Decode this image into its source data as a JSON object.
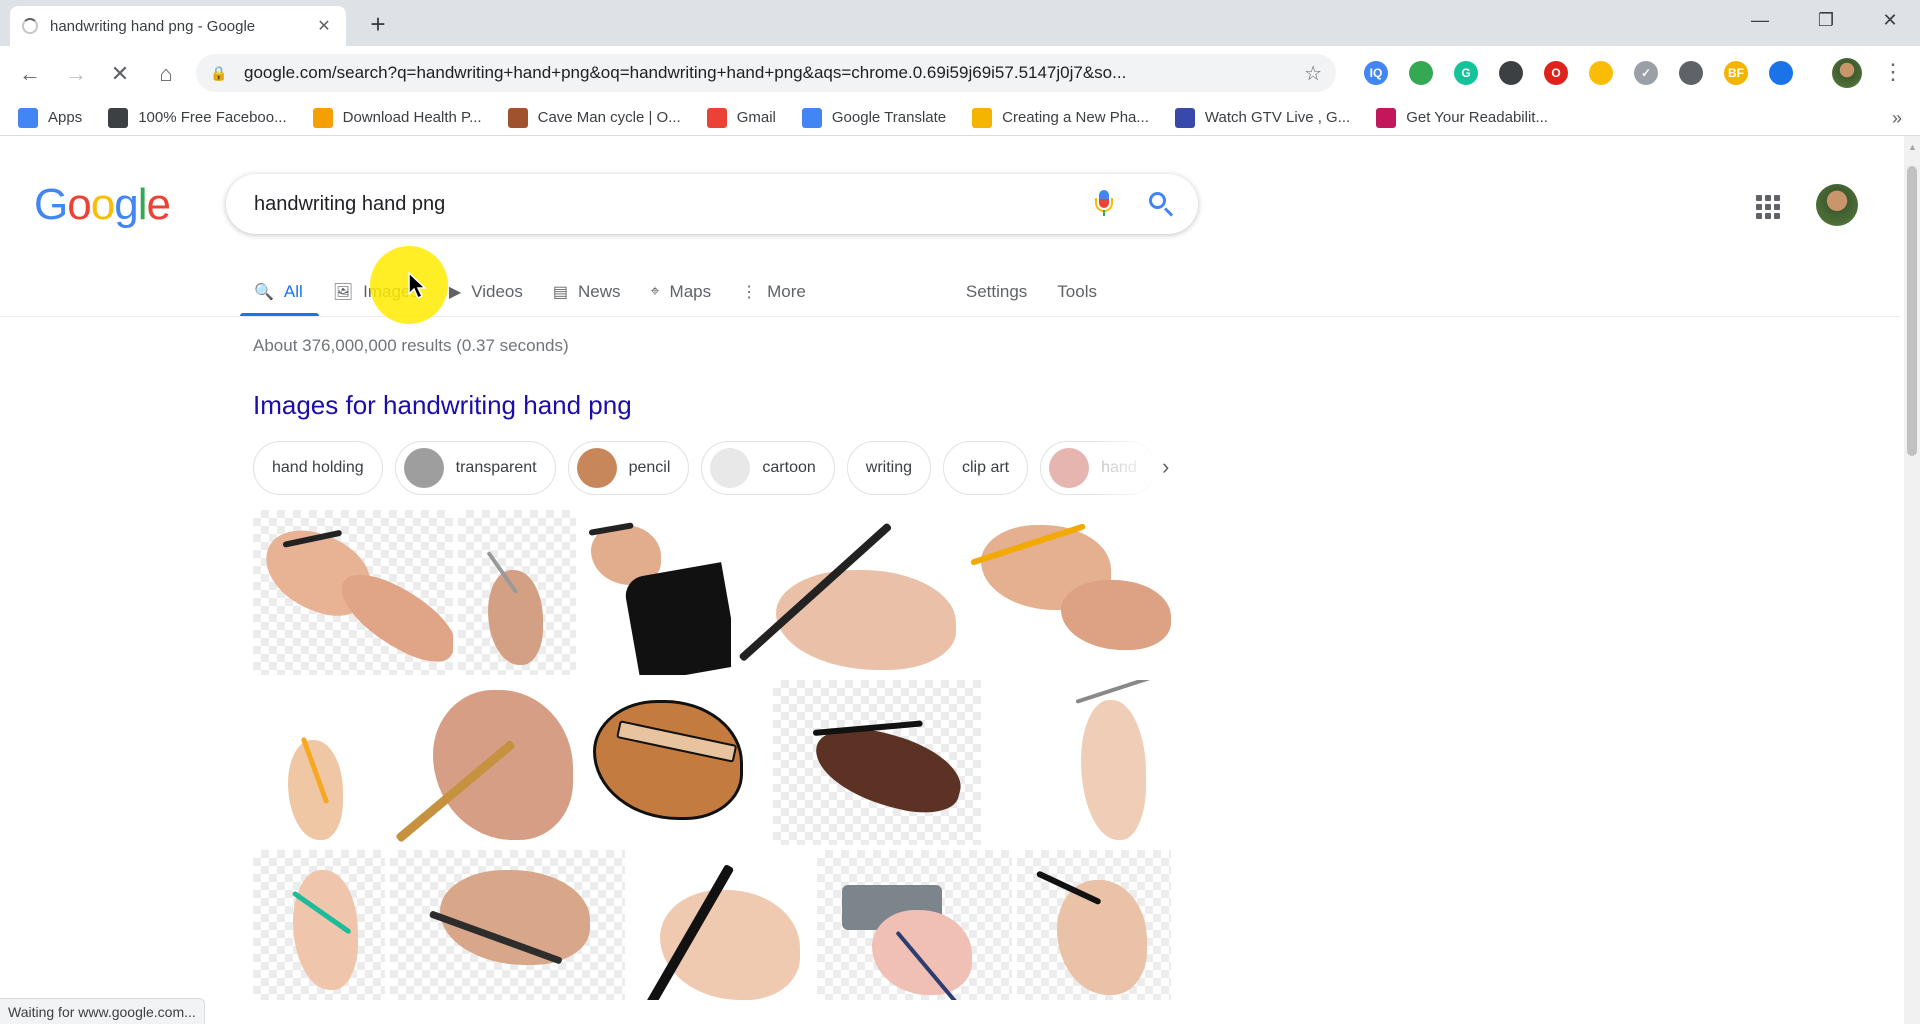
{
  "browser": {
    "tab_title": "handwriting hand png - Google",
    "tab_close": "✕",
    "new_tab": "+",
    "url": "google.com/search?q=handwriting+hand+png&oq=handwriting+hand+png&aqs=chrome.0.69i59j69i57.5147j0j7&so...",
    "extensions": [
      {
        "name": "IQ",
        "label": "IQ",
        "color": "#4285f4"
      },
      {
        "name": "feather-extension",
        "label": "",
        "color": "#34a853"
      },
      {
        "name": "grammarly-extension",
        "label": "G",
        "color": "#15c39a"
      },
      {
        "name": "clip-extension",
        "label": "",
        "color": "#3c4043"
      },
      {
        "name": "opera-extension",
        "label": "O",
        "color": "#e0221c"
      },
      {
        "name": "colorpicker-extension",
        "label": "",
        "color": "#fbbc05"
      },
      {
        "name": "check-extension",
        "label": "✓",
        "color": "#9aa0a6"
      },
      {
        "name": "vpn-extension",
        "label": "",
        "color": "#5f6368"
      },
      {
        "name": "bf-extension",
        "label": "BF",
        "color": "#f4b400"
      },
      {
        "name": "bookmark-extension",
        "label": "",
        "color": "#1a73e8"
      }
    ]
  },
  "bookmarks": [
    {
      "label": "Apps",
      "icon": "apps-grid-icon",
      "color": "#4285f4"
    },
    {
      "label": "100% Free Faceboo...",
      "icon": "at-icon",
      "color": "#3c4043"
    },
    {
      "label": "Download Health P...",
      "icon": "health-icon",
      "color": "#f4a000"
    },
    {
      "label": "Cave Man cycle | O...",
      "icon": "caveman-icon",
      "color": "#a0522d"
    },
    {
      "label": "Gmail",
      "icon": "gmail-icon",
      "color": "#ea4335"
    },
    {
      "label": "Google Translate",
      "icon": "translate-icon",
      "color": "#4285f4"
    },
    {
      "label": "Creating a New Pha...",
      "icon": "slides-icon",
      "color": "#f4b400"
    },
    {
      "label": "Watch GTV Live , G...",
      "icon": "gtv-icon",
      "color": "#3949ab"
    },
    {
      "label": "Get Your Readabilit...",
      "icon": "readability-icon",
      "color": "#c2185b"
    }
  ],
  "search": {
    "logo": [
      "G",
      "o",
      "o",
      "g",
      "l",
      "e"
    ],
    "query": "handwriting hand png",
    "tabs": [
      {
        "label": "All",
        "icon": "🔍",
        "active": true
      },
      {
        "label": "Images",
        "icon": "🖼",
        "active": false
      },
      {
        "label": "Videos",
        "icon": "▶",
        "active": false
      },
      {
        "label": "News",
        "icon": "▤",
        "active": false
      },
      {
        "label": "Maps",
        "icon": "⌖",
        "active": false
      },
      {
        "label": "More",
        "icon": "⋮",
        "active": false
      }
    ],
    "tools": [
      "Settings",
      "Tools"
    ],
    "stats": "About 376,000,000 results (0.37 seconds)",
    "images_heading": "Images for handwriting hand png",
    "chips": [
      {
        "label": "hand holding",
        "thumb": false
      },
      {
        "label": "transparent",
        "thumb": true,
        "color": "#9e9e9e"
      },
      {
        "label": "pencil",
        "thumb": true,
        "color": "#c8875a"
      },
      {
        "label": "cartoon",
        "thumb": true,
        "color": "#e8e8e8"
      },
      {
        "label": "writing",
        "thumb": false
      },
      {
        "label": "clip art",
        "thumb": false
      },
      {
        "label": "hand",
        "thumb": true,
        "color": "#e6b5b0"
      }
    ]
  },
  "status": "Waiting for www.google.com..."
}
